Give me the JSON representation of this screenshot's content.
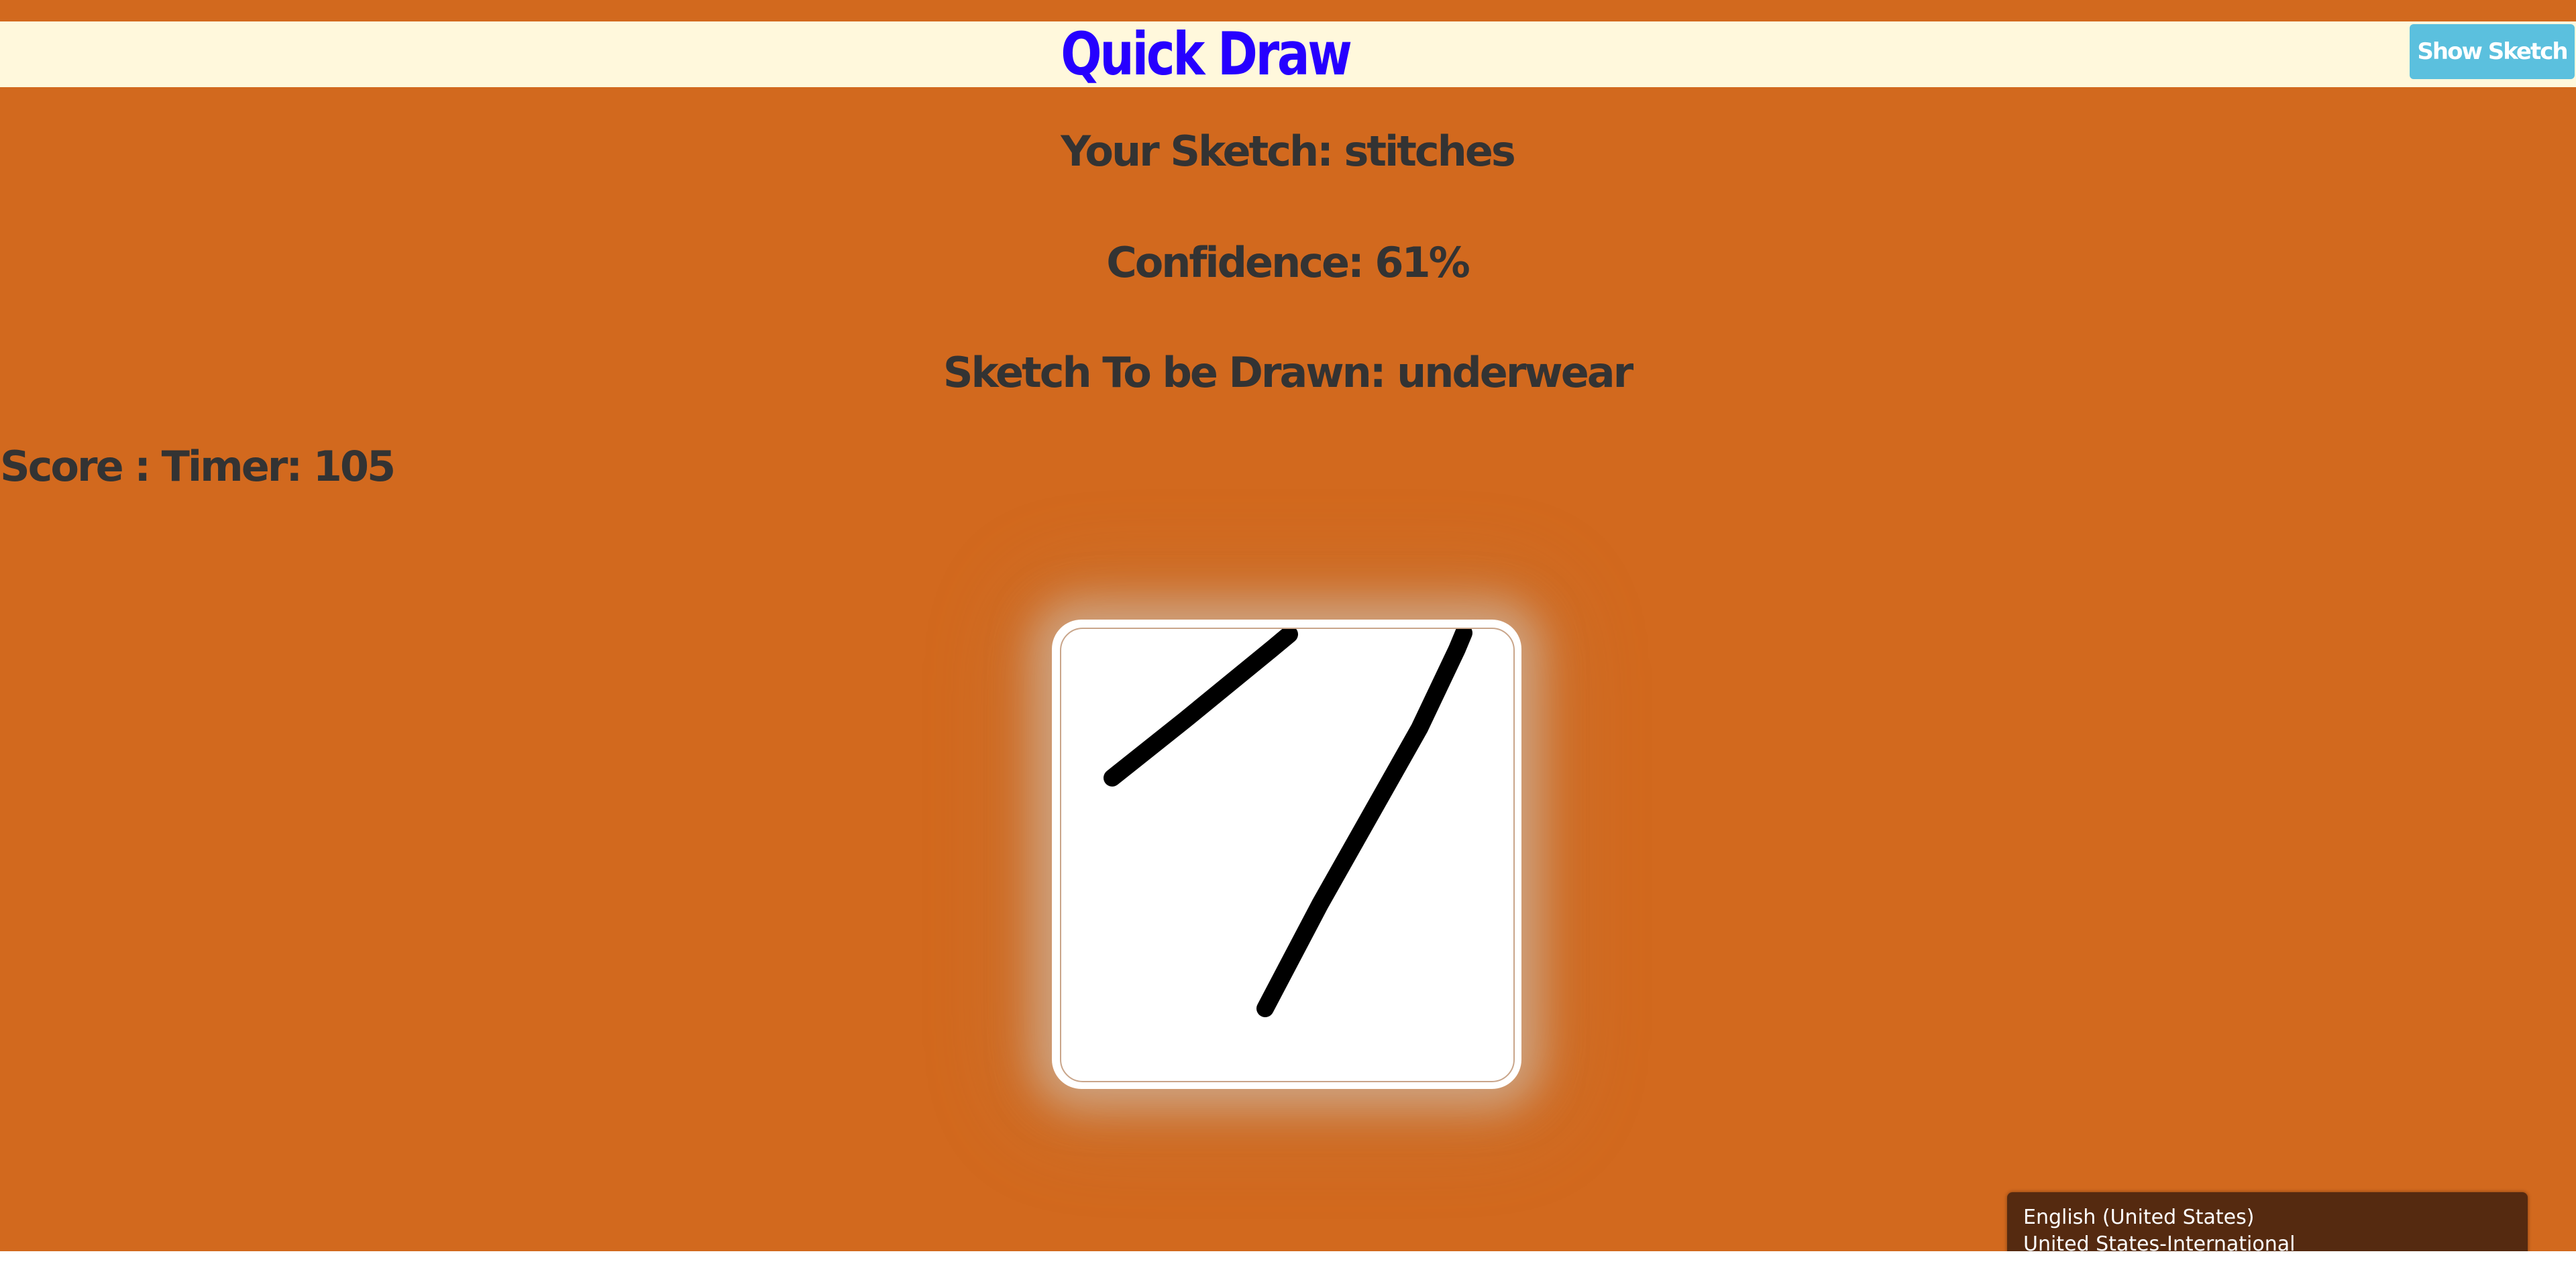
{
  "header": {
    "title": "Quick Draw",
    "show_sketch_label": "Show Sketch"
  },
  "info": {
    "your_sketch": "Your Sketch: stitches",
    "confidence": "Confidence: 61%",
    "sketch_to_draw": "Sketch To be Drawn: underwear",
    "score_timer": "Score : Timer: 105"
  },
  "language_popup": {
    "language": "English (United States)",
    "keyboard": "United States-International"
  },
  "colors": {
    "background": "#d2691e",
    "header_bar": "#fff8dc",
    "title": "#2600ff",
    "button": "#5bc0de",
    "text": "#333333",
    "stroke": "#000000"
  }
}
